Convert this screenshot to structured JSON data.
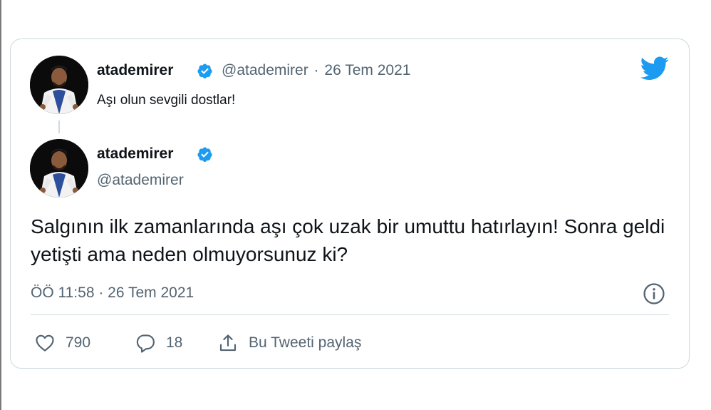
{
  "quoted_tweet": {
    "display_name": "atademirer",
    "handle": "@atademirer",
    "separator": "·",
    "date": "26 Tem 2021",
    "text": "Aşı olun sevgili dostlar!"
  },
  "main_tweet": {
    "display_name": "atademirer",
    "handle": "@atademirer",
    "text": "Salgının ilk zamanlarında aşı çok uzak bir umuttu hatırlayın! Sonra geldi yetişti ama neden olmuyorsunuz ki?",
    "timestamp": "ÖÖ 11:58 · 26 Tem 2021"
  },
  "actions": {
    "like_count": "790",
    "reply_count": "18",
    "share_label": "Bu Tweeti paylaş"
  },
  "icons": {
    "brand": "twitter-bird-icon",
    "verified": "verified-badge-icon",
    "info": "info-icon",
    "like": "heart-icon",
    "reply": "reply-bubble-icon",
    "share": "share-icon"
  },
  "colors": {
    "twitter_blue": "#1d9bf0",
    "text_primary": "#0f1419",
    "text_secondary": "#536471",
    "border": "#cfd9de"
  }
}
